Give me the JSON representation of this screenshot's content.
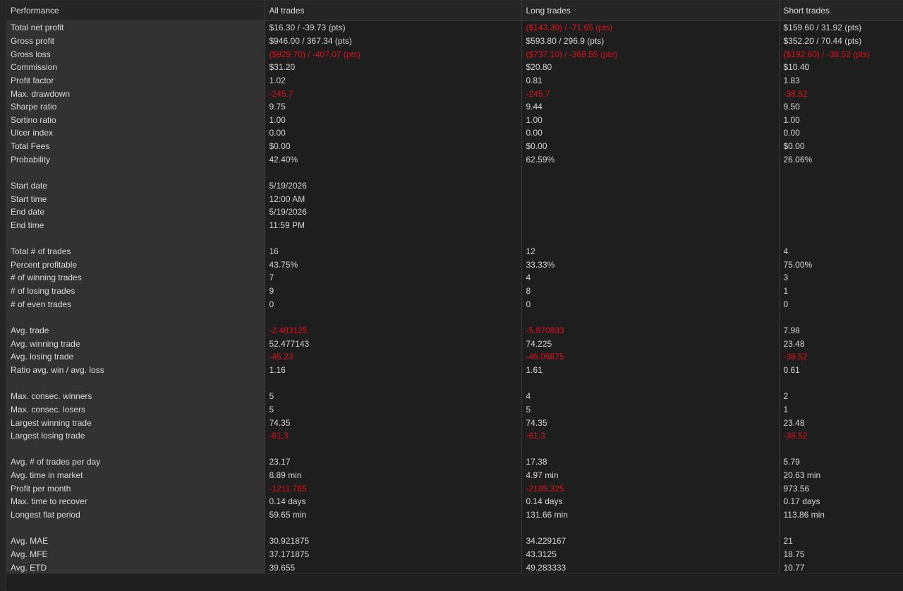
{
  "colors": {
    "negative": "#e0101a",
    "label_column_bg": "#323232",
    "grid_bg": "#1e1e1e",
    "text": "#d6d6d6"
  },
  "headers": [
    "Performance",
    "All trades",
    "Long trades",
    "Short trades"
  ],
  "rows": [
    {
      "label": "Total net profit",
      "values": [
        "$16.30 / -39.73 (pts)",
        "($143.30) / -71.65 (pts)",
        "$159.60 / 31.92 (pts)"
      ],
      "negative": [
        false,
        true,
        false
      ]
    },
    {
      "label": "Gross profit",
      "values": [
        "$946.00 / 367.34 (pts)",
        "$593.80 / 296.9 (pts)",
        "$352.20 / 70.44 (pts)"
      ],
      "negative": [
        false,
        false,
        false
      ]
    },
    {
      "label": "Gross loss",
      "values": [
        "($929.70) / -407.07 (pts)",
        "($737.10) / -368.55 (pts)",
        "($192.60) / -38.52 (pts)"
      ],
      "negative": [
        true,
        true,
        true
      ]
    },
    {
      "label": "Commission",
      "values": [
        "$31.20",
        "$20.80",
        "$10.40"
      ],
      "negative": [
        false,
        false,
        false
      ]
    },
    {
      "label": "Profit factor",
      "values": [
        "1.02",
        "0.81",
        "1.83"
      ],
      "negative": [
        false,
        false,
        false
      ]
    },
    {
      "label": "Max. drawdown",
      "values": [
        "-245.7",
        "-245.7",
        "-38.52"
      ],
      "negative": [
        true,
        true,
        true
      ]
    },
    {
      "label": "Sharpe ratio",
      "values": [
        "9.75",
        "9.44",
        "9.50"
      ],
      "negative": [
        false,
        false,
        false
      ]
    },
    {
      "label": "Sortino ratio",
      "values": [
        "1.00",
        "1.00",
        "1.00"
      ],
      "negative": [
        false,
        false,
        false
      ]
    },
    {
      "label": "Ulcer index",
      "values": [
        "0.00",
        "0.00",
        "0.00"
      ],
      "negative": [
        false,
        false,
        false
      ]
    },
    {
      "label": "Total Fees",
      "values": [
        "$0.00",
        "$0.00",
        "$0.00"
      ],
      "negative": [
        false,
        false,
        false
      ]
    },
    {
      "label": "Probability",
      "values": [
        "42.40%",
        "62.59%",
        "26.06%"
      ],
      "negative": [
        false,
        false,
        false
      ]
    },
    {
      "label": "",
      "values": [
        "",
        "",
        ""
      ],
      "negative": [
        false,
        false,
        false
      ]
    },
    {
      "label": "Start date",
      "values": [
        "5/19/2026",
        "",
        ""
      ],
      "negative": [
        false,
        false,
        false
      ]
    },
    {
      "label": "Start time",
      "values": [
        "12:00 AM",
        "",
        ""
      ],
      "negative": [
        false,
        false,
        false
      ]
    },
    {
      "label": "End date",
      "values": [
        "5/19/2026",
        "",
        ""
      ],
      "negative": [
        false,
        false,
        false
      ]
    },
    {
      "label": "End time",
      "values": [
        "11:59 PM",
        "",
        ""
      ],
      "negative": [
        false,
        false,
        false
      ]
    },
    {
      "label": "",
      "values": [
        "",
        "",
        ""
      ],
      "negative": [
        false,
        false,
        false
      ]
    },
    {
      "label": "Total # of trades",
      "values": [
        "16",
        "12",
        "4"
      ],
      "negative": [
        false,
        false,
        false
      ]
    },
    {
      "label": "Percent profitable",
      "values": [
        "43.75%",
        "33.33%",
        "75.00%"
      ],
      "negative": [
        false,
        false,
        false
      ]
    },
    {
      "label": "# of winning trades",
      "values": [
        "7",
        "4",
        "3"
      ],
      "negative": [
        false,
        false,
        false
      ]
    },
    {
      "label": "# of losing trades",
      "values": [
        "9",
        "8",
        "1"
      ],
      "negative": [
        false,
        false,
        false
      ]
    },
    {
      "label": "# of even trades",
      "values": [
        "0",
        "0",
        "0"
      ],
      "negative": [
        false,
        false,
        false
      ]
    },
    {
      "label": "",
      "values": [
        "",
        "",
        ""
      ],
      "negative": [
        false,
        false,
        false
      ]
    },
    {
      "label": "Avg. trade",
      "values": [
        "-2.483125",
        "-5.970833",
        "7.98"
      ],
      "negative": [
        true,
        true,
        false
      ]
    },
    {
      "label": "Avg. winning trade",
      "values": [
        "52.477143",
        "74.225",
        "23.48"
      ],
      "negative": [
        false,
        false,
        false
      ]
    },
    {
      "label": "Avg. losing trade",
      "values": [
        "-45.23",
        "-46.06875",
        "-38.52"
      ],
      "negative": [
        true,
        true,
        true
      ]
    },
    {
      "label": "Ratio avg. win / avg. loss",
      "values": [
        "1.16",
        "1.61",
        "0.61"
      ],
      "negative": [
        false,
        false,
        false
      ]
    },
    {
      "label": "",
      "values": [
        "",
        "",
        ""
      ],
      "negative": [
        false,
        false,
        false
      ]
    },
    {
      "label": "Max. consec. winners",
      "values": [
        "5",
        "4",
        "2"
      ],
      "negative": [
        false,
        false,
        false
      ]
    },
    {
      "label": "Max. consec. losers",
      "values": [
        "5",
        "5",
        "1"
      ],
      "negative": [
        false,
        false,
        false
      ]
    },
    {
      "label": "Largest winning trade",
      "values": [
        "74.35",
        "74.35",
        "23.48"
      ],
      "negative": [
        false,
        false,
        false
      ]
    },
    {
      "label": "Largest losing trade",
      "values": [
        "-61.3",
        "-61.3",
        "-38.52"
      ],
      "negative": [
        true,
        true,
        true
      ]
    },
    {
      "label": "",
      "values": [
        "",
        "",
        ""
      ],
      "negative": [
        false,
        false,
        false
      ]
    },
    {
      "label": "Avg. # of trades per day",
      "values": [
        "23.17",
        "17.38",
        "5.79"
      ],
      "negative": [
        false,
        false,
        false
      ]
    },
    {
      "label": "Avg. time in market",
      "values": [
        "8.89 min",
        "4.97 min",
        "20.63 min"
      ],
      "negative": [
        false,
        false,
        false
      ]
    },
    {
      "label": "Profit per month",
      "values": [
        "-1211.765",
        "-2185.325",
        "973.56"
      ],
      "negative": [
        true,
        true,
        false
      ]
    },
    {
      "label": "Max. time to recover",
      "values": [
        "0.14 days",
        "0.14 days",
        "0.17 days"
      ],
      "negative": [
        false,
        false,
        false
      ]
    },
    {
      "label": "Longest flat period",
      "values": [
        "59.65 min",
        "131.66 min",
        "113.86 min"
      ],
      "negative": [
        false,
        false,
        false
      ]
    },
    {
      "label": "",
      "values": [
        "",
        "",
        ""
      ],
      "negative": [
        false,
        false,
        false
      ]
    },
    {
      "label": "Avg. MAE",
      "values": [
        "30.921875",
        "34.229167",
        "21"
      ],
      "negative": [
        false,
        false,
        false
      ]
    },
    {
      "label": "Avg. MFE",
      "values": [
        "37.171875",
        "43.3125",
        "18.75"
      ],
      "negative": [
        false,
        false,
        false
      ]
    },
    {
      "label": "Avg. ETD",
      "values": [
        "39.655",
        "49.283333",
        "10.77"
      ],
      "negative": [
        false,
        false,
        false
      ]
    }
  ]
}
